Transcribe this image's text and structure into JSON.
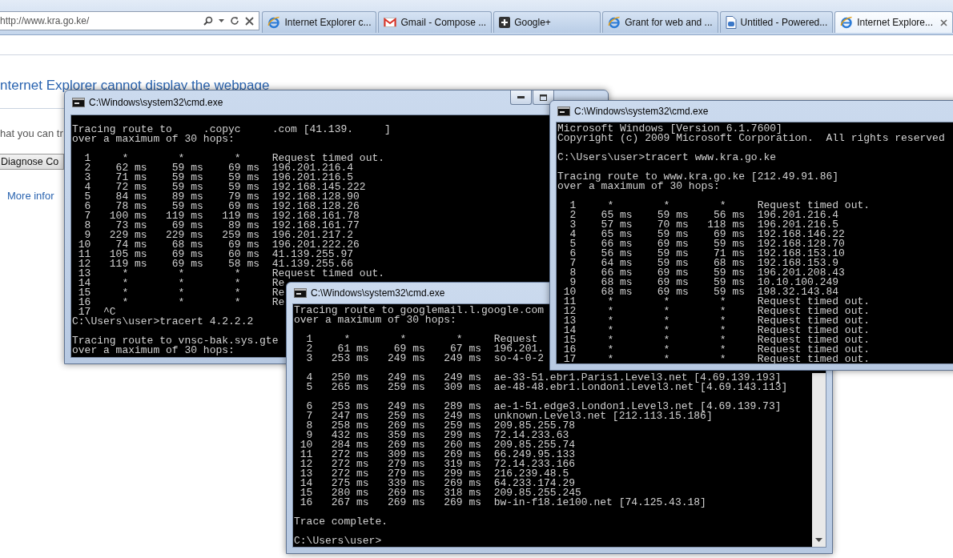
{
  "browser": {
    "address": "http://www.kra.go.ke/",
    "tabs": [
      {
        "label": "Internet Explorer c...",
        "kind": "browser",
        "selected": false
      },
      {
        "label": "Gmail - Compose ...",
        "kind": "mail",
        "selected": false
      },
      {
        "label": "Google+",
        "kind": "plus",
        "selected": false
      },
      {
        "label": "Grant for web and ...",
        "kind": "browser",
        "selected": false
      },
      {
        "label": "Untitled - Powered...",
        "kind": "document",
        "selected": false
      },
      {
        "label": "Internet Explore...",
        "kind": "browser",
        "selected": true
      }
    ]
  },
  "page": {
    "heading": "nternet Explorer cannot display the webpage",
    "text": "hat you can tr",
    "diagnose_button": "Diagnose Co",
    "link": "More infor"
  },
  "consoles": [
    {
      "title": "C:\\Windows\\system32\\cmd.exe",
      "blocks": [
        [
          "Tracing route to     .copyc     .com [41.139.     ]",
          "over a maximum of 30 hops:"
        ],
        [
          "  1     *        *        *     Request timed out.",
          "  2    62 ms    59 ms    69 ms  196.201.216.4",
          "  3    71 ms    59 ms    59 ms  196.201.216.5",
          "  4    72 ms    59 ms    59 ms  192.168.145.222",
          "  5    84 ms    89 ms    79 ms  192.168.128.90",
          "  6    78 ms    59 ms    69 ms  192.168.128.26",
          "  7   100 ms   119 ms   119 ms  192.168.161.78",
          "  8    73 ms    69 ms    89 ms  192.168.161.77",
          "  9   229 ms   229 ms   259 ms  196.201.217.2",
          " 10    74 ms    68 ms    69 ms  196.201.222.26",
          " 11   105 ms    69 ms    60 ms  41.139.255.97",
          " 12   119 ms    69 ms    58 ms  41.139.255.66",
          " 13     *        *        *     Request timed out.",
          " 14     *        *        *     Re",
          " 15     *        *        *     Re",
          " 16     *        *        *     Re",
          " 17  ^C",
          "C:\\Users\\user>tracert 4.2.2.2"
        ],
        [
          "Tracing route to vnsc-bak.sys.gte",
          "over a maximum of 30 hops:"
        ]
      ]
    },
    {
      "title": "C:\\Windows\\system32\\cmd.exe",
      "blocks": [
        [
          "Microsoft Windows [Version 6.1.7600]",
          "Copyright (c) 2009 Microsoft Corporation.  All rights reserved"
        ],
        [
          "C:\\Users\\user>tracert www.kra.go.ke"
        ],
        [
          "Tracing route to www.kra.go.ke [212.49.91.86]",
          "over a maximum of 30 hops:"
        ],
        [
          "  1     *        *        *     Request timed out.",
          "  2    65 ms    59 ms    56 ms  196.201.216.4",
          "  3    57 ms    70 ms   118 ms  196.201.216.5",
          "  4    65 ms    59 ms    69 ms  192.168.146.22",
          "  5    66 ms    69 ms    59 ms  192.168.128.70",
          "  6    56 ms    59 ms    71 ms  192.168.153.10",
          "  7    64 ms    59 ms    68 ms  192.168.153.9",
          "  8    66 ms    69 ms    59 ms  196.201.208.43",
          "  9    68 ms    69 ms    59 ms  10.10.100.249",
          " 10    68 ms    69 ms    59 ms  198.32.143.84",
          " 11     *        *        *     Request timed out.",
          " 12     *        *        *     Request timed out.",
          " 13     *        *        *     Request timed out.",
          " 14     *        *        *     Request timed out.",
          " 15     *        *        *     Request timed out.",
          " 16     *        *        *     Request timed out.",
          " 17     *        *        *     Request timed out."
        ]
      ]
    },
    {
      "title": "C:\\Windows\\system32\\cmd.exe",
      "blocks": [
        [
          "Tracing route to googlemail.l.google.com",
          "over a maximum of 30 hops:"
        ],
        [
          "  1     *        *        *     Request",
          "  2    61 ms    69 ms    67 ms  196.201.",
          "  3   253 ms   249 ms   249 ms  so-4-0-2"
        ],
        [
          "  4   250 ms   249 ms   249 ms  ae-33-51.ebr1.Paris1.Level3.net [4.69.139.193]",
          "  5   265 ms   259 ms   309 ms  ae-48-48.ebr1.London1.Level3.net [4.69.143.113]"
        ],
        [
          "  6   253 ms   249 ms   289 ms  ae-1-51.edge3.London1.Level3.net [4.69.139.73]",
          "  7   247 ms   259 ms   249 ms  unknown.Level3.net [212.113.15.186]",
          "  8   258 ms   269 ms   259 ms  209.85.255.78",
          "  9   432 ms   359 ms   299 ms  72.14.233.63",
          " 10   284 ms   269 ms   260 ms  209.85.255.74",
          " 11   272 ms   309 ms   269 ms  66.249.95.133",
          " 12   272 ms   279 ms   319 ms  72.14.233.166",
          " 13   272 ms   279 ms   299 ms  216.239.48.5",
          " 14   275 ms   339 ms   269 ms  64.233.174.29",
          " 15   280 ms   269 ms   318 ms  209.85.255.245",
          " 16   267 ms   269 ms   269 ms  bw-in-f18.1e100.net [74.125.43.18]"
        ],
        [
          "Trace complete."
        ],
        [
          "C:\\Users\\user>"
        ]
      ]
    }
  ]
}
